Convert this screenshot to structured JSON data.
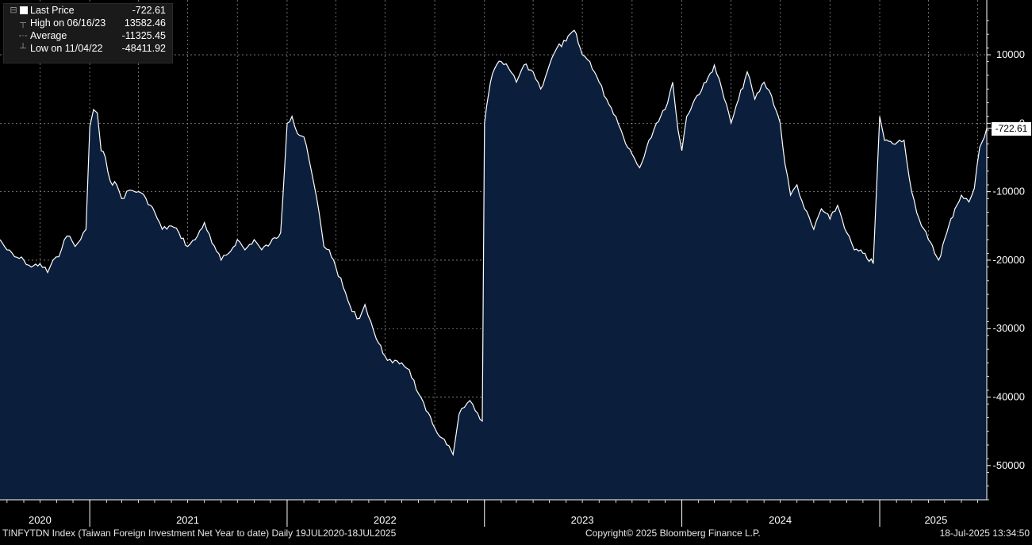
{
  "legend": {
    "last_price_label": "Last Price",
    "last_price_value": "-722.61",
    "high_label": "High on 06/16/23",
    "high_value": "13582.46",
    "average_label": "Average",
    "average_value": "-11325.45",
    "low_label": "Low on 11/04/22",
    "low_value": "-48411.92"
  },
  "last_value_tag": "-722.61",
  "footer": {
    "left": "TINFYTDN Index (Taiwan Foreign Investment Net Year to date)  Daily 19JUL2020-18JUL2025",
    "center": "Copyright© 2025 Bloomberg Finance L.P.",
    "right": "18-Jul-2025 13:34:50"
  },
  "colors": {
    "background": "#000000",
    "area_fill": "#0b1f3c",
    "line": "#ffffff",
    "grid": "#8a8a8a",
    "text": "#ffffff"
  },
  "chart_data": {
    "type": "area",
    "title": "",
    "xlabel": "",
    "ylabel": "",
    "ylim": [
      -55000,
      18000
    ],
    "yticks": [
      10000,
      0,
      -10000,
      -20000,
      -30000,
      -40000,
      -50000
    ],
    "ytick_labels": [
      "10000",
      "0",
      "-10000",
      "-20000",
      "-30000",
      "-40000",
      "-50000"
    ],
    "xlim": [
      "2020-07-19",
      "2025-07-18"
    ],
    "year_labels": [
      "2020",
      "2021",
      "2022",
      "2023",
      "2024",
      "2025"
    ],
    "year_label_dates": [
      "2020-10-01",
      "2021-07-01",
      "2022-07-01",
      "2023-07-01",
      "2024-07-01",
      "2025-04-15"
    ],
    "year_boundaries": [
      "2021-01-01",
      "2022-01-01",
      "2023-01-01",
      "2024-01-01",
      "2025-01-01"
    ],
    "series": [
      {
        "points": [
          [
            "2020-07-19",
            -17000
          ],
          [
            "2020-08-01",
            -18500
          ],
          [
            "2020-08-15",
            -19500
          ],
          [
            "2020-09-01",
            -20000
          ],
          [
            "2020-09-15",
            -21000
          ],
          [
            "2020-10-01",
            -20500
          ],
          [
            "2020-10-15",
            -21800
          ],
          [
            "2020-10-25",
            -20000
          ],
          [
            "2020-11-05",
            -19500
          ],
          [
            "2020-11-15",
            -17000
          ],
          [
            "2020-11-25",
            -16500
          ],
          [
            "2020-12-05",
            -18000
          ],
          [
            "2020-12-15",
            -17000
          ],
          [
            "2020-12-25",
            -15500
          ],
          [
            "2021-01-01",
            -500
          ],
          [
            "2021-01-08",
            2000
          ],
          [
            "2021-01-15",
            1500
          ],
          [
            "2021-01-22",
            -4000
          ],
          [
            "2021-01-30",
            -5000
          ],
          [
            "2021-02-08",
            -8500
          ],
          [
            "2021-02-20",
            -9000
          ],
          [
            "2021-03-01",
            -11000
          ],
          [
            "2021-03-15",
            -9800
          ],
          [
            "2021-04-01",
            -10000
          ],
          [
            "2021-04-15",
            -11000
          ],
          [
            "2021-05-01",
            -13000
          ],
          [
            "2021-05-15",
            -15500
          ],
          [
            "2021-06-01",
            -15000
          ],
          [
            "2021-06-15",
            -16000
          ],
          [
            "2021-07-01",
            -18000
          ],
          [
            "2021-07-15",
            -17000
          ],
          [
            "2021-08-01",
            -14500
          ],
          [
            "2021-08-15",
            -17500
          ],
          [
            "2021-09-01",
            -20000
          ],
          [
            "2021-09-15",
            -19000
          ],
          [
            "2021-10-01",
            -17000
          ],
          [
            "2021-10-15",
            -18500
          ],
          [
            "2021-11-01",
            -17000
          ],
          [
            "2021-11-15",
            -18500
          ],
          [
            "2021-12-01",
            -17500
          ],
          [
            "2021-12-20",
            -16000
          ],
          [
            "2022-01-01",
            0
          ],
          [
            "2022-01-10",
            1000
          ],
          [
            "2022-01-20",
            -1500
          ],
          [
            "2022-02-01",
            -2000
          ],
          [
            "2022-02-15",
            -7000
          ],
          [
            "2022-03-01",
            -13000
          ],
          [
            "2022-03-10",
            -18000
          ],
          [
            "2022-03-20",
            -18500
          ],
          [
            "2022-04-01",
            -21000
          ],
          [
            "2022-04-15",
            -24000
          ],
          [
            "2022-05-01",
            -27500
          ],
          [
            "2022-05-15",
            -28500
          ],
          [
            "2022-05-25",
            -26500
          ],
          [
            "2022-06-05",
            -29000
          ],
          [
            "2022-06-15",
            -31500
          ],
          [
            "2022-07-01",
            -34000
          ],
          [
            "2022-07-15",
            -35000
          ],
          [
            "2022-08-01",
            -35000
          ],
          [
            "2022-08-15",
            -36000
          ],
          [
            "2022-09-01",
            -39500
          ],
          [
            "2022-09-15",
            -42000
          ],
          [
            "2022-10-01",
            -44500
          ],
          [
            "2022-10-15",
            -46000
          ],
          [
            "2022-11-04",
            -48411.92
          ],
          [
            "2022-11-15",
            -42500
          ],
          [
            "2022-11-25",
            -41500
          ],
          [
            "2022-12-05",
            -40500
          ],
          [
            "2022-12-15",
            -42000
          ],
          [
            "2022-12-28",
            -43500
          ],
          [
            "2023-01-01",
            0
          ],
          [
            "2023-01-05",
            2500
          ],
          [
            "2023-01-12",
            6000
          ],
          [
            "2023-01-20",
            8000
          ],
          [
            "2023-02-01",
            9000
          ],
          [
            "2023-02-15",
            8000
          ],
          [
            "2023-03-01",
            6000
          ],
          [
            "2023-03-15",
            8500
          ],
          [
            "2023-04-01",
            7500
          ],
          [
            "2023-04-15",
            5000
          ],
          [
            "2023-05-01",
            8500
          ],
          [
            "2023-05-15",
            11000
          ],
          [
            "2023-06-01",
            12000
          ],
          [
            "2023-06-16",
            13582.46
          ],
          [
            "2023-07-01",
            10000
          ],
          [
            "2023-07-15",
            9000
          ],
          [
            "2023-08-01",
            6000
          ],
          [
            "2023-08-15",
            3500
          ],
          [
            "2023-09-01",
            1000
          ],
          [
            "2023-09-15",
            -2000
          ],
          [
            "2023-10-01",
            -4500
          ],
          [
            "2023-10-15",
            -6500
          ],
          [
            "2023-11-01",
            -2500
          ],
          [
            "2023-11-15",
            0
          ],
          [
            "2023-12-01",
            2000
          ],
          [
            "2023-12-15",
            6000
          ],
          [
            "2023-12-25",
            -1000
          ],
          [
            "2024-01-01",
            -4000
          ],
          [
            "2024-01-10",
            1000
          ],
          [
            "2024-01-25",
            3500
          ],
          [
            "2024-02-15",
            6000
          ],
          [
            "2024-03-01",
            8500
          ],
          [
            "2024-03-15",
            5000
          ],
          [
            "2024-04-01",
            0
          ],
          [
            "2024-04-15",
            3500
          ],
          [
            "2024-05-01",
            7500
          ],
          [
            "2024-05-15",
            3500
          ],
          [
            "2024-06-01",
            6000
          ],
          [
            "2024-06-15",
            4000
          ],
          [
            "2024-07-01",
            0
          ],
          [
            "2024-07-10",
            -6000
          ],
          [
            "2024-07-20",
            -10500
          ],
          [
            "2024-08-01",
            -9000
          ],
          [
            "2024-08-15",
            -12500
          ],
          [
            "2024-09-01",
            -15500
          ],
          [
            "2024-09-15",
            -12500
          ],
          [
            "2024-10-01",
            -14000
          ],
          [
            "2024-10-15",
            -12000
          ],
          [
            "2024-11-01",
            -16000
          ],
          [
            "2024-11-15",
            -18500
          ],
          [
            "2024-12-01",
            -19000
          ],
          [
            "2024-12-20",
            -20500
          ],
          [
            "2025-01-01",
            1000
          ],
          [
            "2025-01-10",
            -2500
          ],
          [
            "2025-01-25",
            -3000
          ],
          [
            "2025-02-15",
            -2500
          ],
          [
            "2025-03-01",
            -10000
          ],
          [
            "2025-03-15",
            -14000
          ],
          [
            "2025-04-01",
            -17000
          ],
          [
            "2025-04-20",
            -20000
          ],
          [
            "2025-05-05",
            -16000
          ],
          [
            "2025-05-20",
            -12500
          ],
          [
            "2025-06-01",
            -10500
          ],
          [
            "2025-06-15",
            -11500
          ],
          [
            "2025-06-25",
            -9500
          ],
          [
            "2025-07-05",
            -3500
          ],
          [
            "2025-07-18",
            -722.61
          ]
        ]
      }
    ],
    "grid": true
  }
}
